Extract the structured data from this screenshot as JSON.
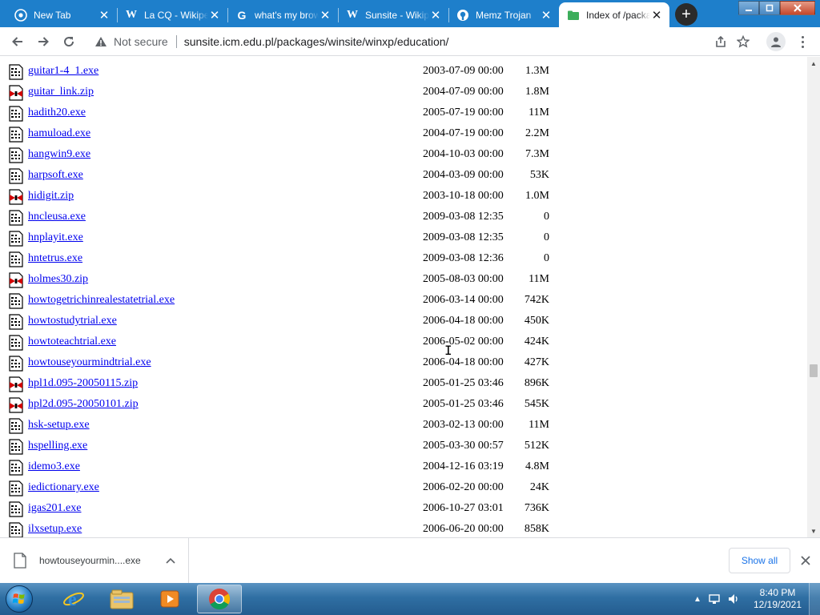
{
  "colors": {
    "tabstrip": "#1e7fcb",
    "link": "#0000ee",
    "accent": "#1a73e8"
  },
  "tabs": [
    {
      "title": "New Tab",
      "icon": "chrome-icon",
      "active": false
    },
    {
      "title": "La CQ - Wikipedia",
      "icon": "wikipedia-icon",
      "active": false
    },
    {
      "title": "what's my browser",
      "icon": "google-icon",
      "active": false
    },
    {
      "title": "Sunsite - Wikipedia",
      "icon": "wikipedia-icon",
      "active": false
    },
    {
      "title": "Memz Trojan",
      "icon": "github-icon",
      "active": false
    },
    {
      "title": "Index of /packages",
      "icon": "green-folder-icon",
      "active": true
    }
  ],
  "toolbar": {
    "security_label": "Not secure",
    "url": "sunsite.icm.edu.pl/packages/winsite/winxp/education/"
  },
  "files": [
    {
      "name": "guitar1-4_1.exe",
      "date": "2003-07-09 00:00",
      "size": "1.3M",
      "type": "exe"
    },
    {
      "name": "guitar_link.zip",
      "date": "2004-07-09 00:00",
      "size": "1.8M",
      "type": "zip"
    },
    {
      "name": "hadith20.exe",
      "date": "2005-07-19 00:00",
      "size": "11M",
      "type": "exe"
    },
    {
      "name": "hamuload.exe",
      "date": "2004-07-19 00:00",
      "size": "2.2M",
      "type": "exe"
    },
    {
      "name": "hangwin9.exe",
      "date": "2004-10-03 00:00",
      "size": "7.3M",
      "type": "exe"
    },
    {
      "name": "harpsoft.exe",
      "date": "2004-03-09 00:00",
      "size": "53K",
      "type": "exe"
    },
    {
      "name": "hidigit.zip",
      "date": "2003-10-18 00:00",
      "size": "1.0M",
      "type": "zip"
    },
    {
      "name": "hncleusa.exe",
      "date": "2009-03-08 12:35",
      "size": "0",
      "type": "exe"
    },
    {
      "name": "hnplayit.exe",
      "date": "2009-03-08 12:35",
      "size": "0",
      "type": "exe"
    },
    {
      "name": "hntetrus.exe",
      "date": "2009-03-08 12:36",
      "size": "0",
      "type": "exe"
    },
    {
      "name": "holmes30.zip",
      "date": "2005-08-03 00:00",
      "size": "11M",
      "type": "zip"
    },
    {
      "name": "howtogetrichinrealestatetrial.exe",
      "date": "2006-03-14 00:00",
      "size": "742K",
      "type": "exe"
    },
    {
      "name": "howtostudytrial.exe",
      "date": "2006-04-18 00:00",
      "size": "450K",
      "type": "exe"
    },
    {
      "name": "howtoteachtrial.exe",
      "date": "2006-05-02 00:00",
      "size": "424K",
      "type": "exe"
    },
    {
      "name": "howtouseyourmindtrial.exe",
      "date": "2006-04-18 00:00",
      "size": "427K",
      "type": "exe"
    },
    {
      "name": "hpl1d.095-20050115.zip",
      "date": "2005-01-25 03:46",
      "size": "896K",
      "type": "zip"
    },
    {
      "name": "hpl2d.095-20050101.zip",
      "date": "2005-01-25 03:46",
      "size": "545K",
      "type": "zip"
    },
    {
      "name": "hsk-setup.exe",
      "date": "2003-02-13 00:00",
      "size": "11M",
      "type": "exe"
    },
    {
      "name": "hspelling.exe",
      "date": "2005-03-30 00:57",
      "size": "512K",
      "type": "exe"
    },
    {
      "name": "idemo3.exe",
      "date": "2004-12-16 03:19",
      "size": "4.8M",
      "type": "exe"
    },
    {
      "name": "iedictionary.exe",
      "date": "2006-02-20 00:00",
      "size": "24K",
      "type": "exe"
    },
    {
      "name": "igas201.exe",
      "date": "2006-10-27 03:01",
      "size": "736K",
      "type": "exe"
    },
    {
      "name": "ilxsetup.exe",
      "date": "2006-06-20 00:00",
      "size": "858K",
      "type": "exe"
    }
  ],
  "download_shelf": {
    "filename": "howtouseyourmin....exe",
    "show_all_label": "Show all"
  },
  "taskbar": {
    "apps": [
      {
        "name": "internet-explorer-icon",
        "active": false
      },
      {
        "name": "windows-explorer-icon",
        "active": false
      },
      {
        "name": "media-player-icon",
        "active": false
      },
      {
        "name": "chrome-icon",
        "active": true
      }
    ],
    "clock_time": "8:40 PM",
    "clock_date": "12/19/2021"
  }
}
